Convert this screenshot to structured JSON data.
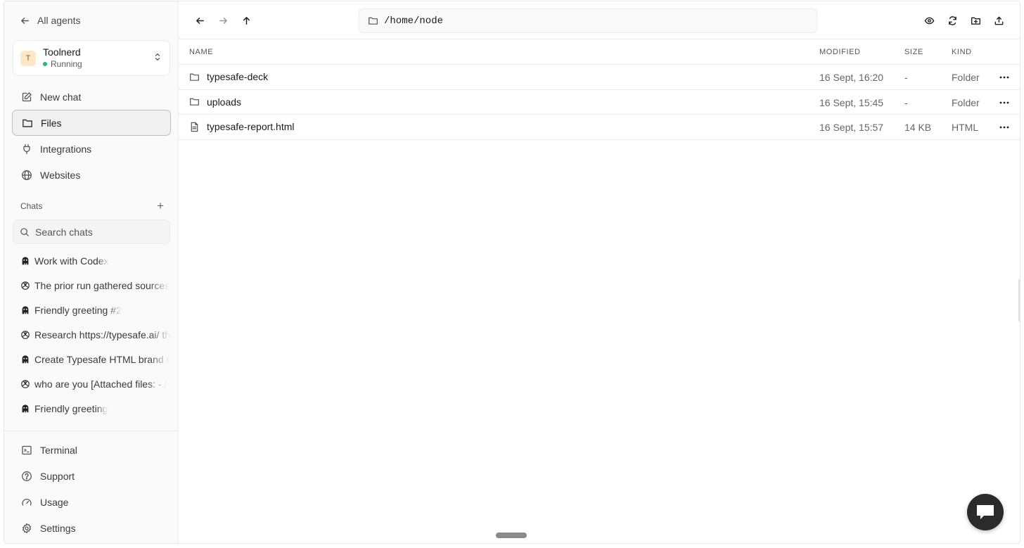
{
  "sidebar": {
    "back_label": "All agents",
    "agent": {
      "initial": "T",
      "name": "Toolnerd",
      "status": "Running"
    },
    "nav": [
      {
        "label": "New chat",
        "icon": "edit-icon"
      },
      {
        "label": "Files",
        "icon": "folder-icon",
        "active": true
      },
      {
        "label": "Integrations",
        "icon": "plug-icon"
      },
      {
        "label": "Websites",
        "icon": "globe-icon"
      }
    ],
    "chats_title": "Chats",
    "chats_add": "+",
    "search_placeholder": "Search chats",
    "chats": [
      {
        "label": "Work with Codex",
        "icon": "codex-icon"
      },
      {
        "label": "The prior run gathered sources",
        "icon": "openai-icon"
      },
      {
        "label": "Friendly greeting #2",
        "icon": "codex-icon"
      },
      {
        "label": "Research https://typesafe.ai/ th",
        "icon": "openai-icon"
      },
      {
        "label": "Create Typesafe HTML brand r",
        "icon": "codex-icon"
      },
      {
        "label": "who are you [Attached files: - /",
        "icon": "openai-icon"
      },
      {
        "label": "Friendly greeting",
        "icon": "codex-icon"
      }
    ],
    "bottom_nav": [
      {
        "label": "Terminal",
        "icon": "terminal-icon"
      },
      {
        "label": "Support",
        "icon": "help-icon"
      },
      {
        "label": "Usage",
        "icon": "gauge-icon"
      },
      {
        "label": "Settings",
        "icon": "gear-icon"
      }
    ]
  },
  "toolbar": {
    "path": "/home/node"
  },
  "table": {
    "headers": {
      "name": "NAME",
      "modified": "MODIFIED",
      "size": "SIZE",
      "kind": "KIND"
    },
    "rows": [
      {
        "name": "typesafe-deck",
        "modified": "16 Sept, 16:20",
        "size": "-",
        "kind": "Folder",
        "icon": "folder-icon"
      },
      {
        "name": "uploads",
        "modified": "16 Sept, 15:45",
        "size": "-",
        "kind": "Folder",
        "icon": "folder-icon"
      },
      {
        "name": "typesafe-report.html",
        "modified": "16 Sept, 15:57",
        "size": "14 KB",
        "kind": "HTML",
        "icon": "file-icon"
      }
    ]
  },
  "colors": {
    "status_running": "#1fbf6a",
    "avatar_bg": "#fde8c8",
    "fab_bg": "#2b2b2b"
  }
}
